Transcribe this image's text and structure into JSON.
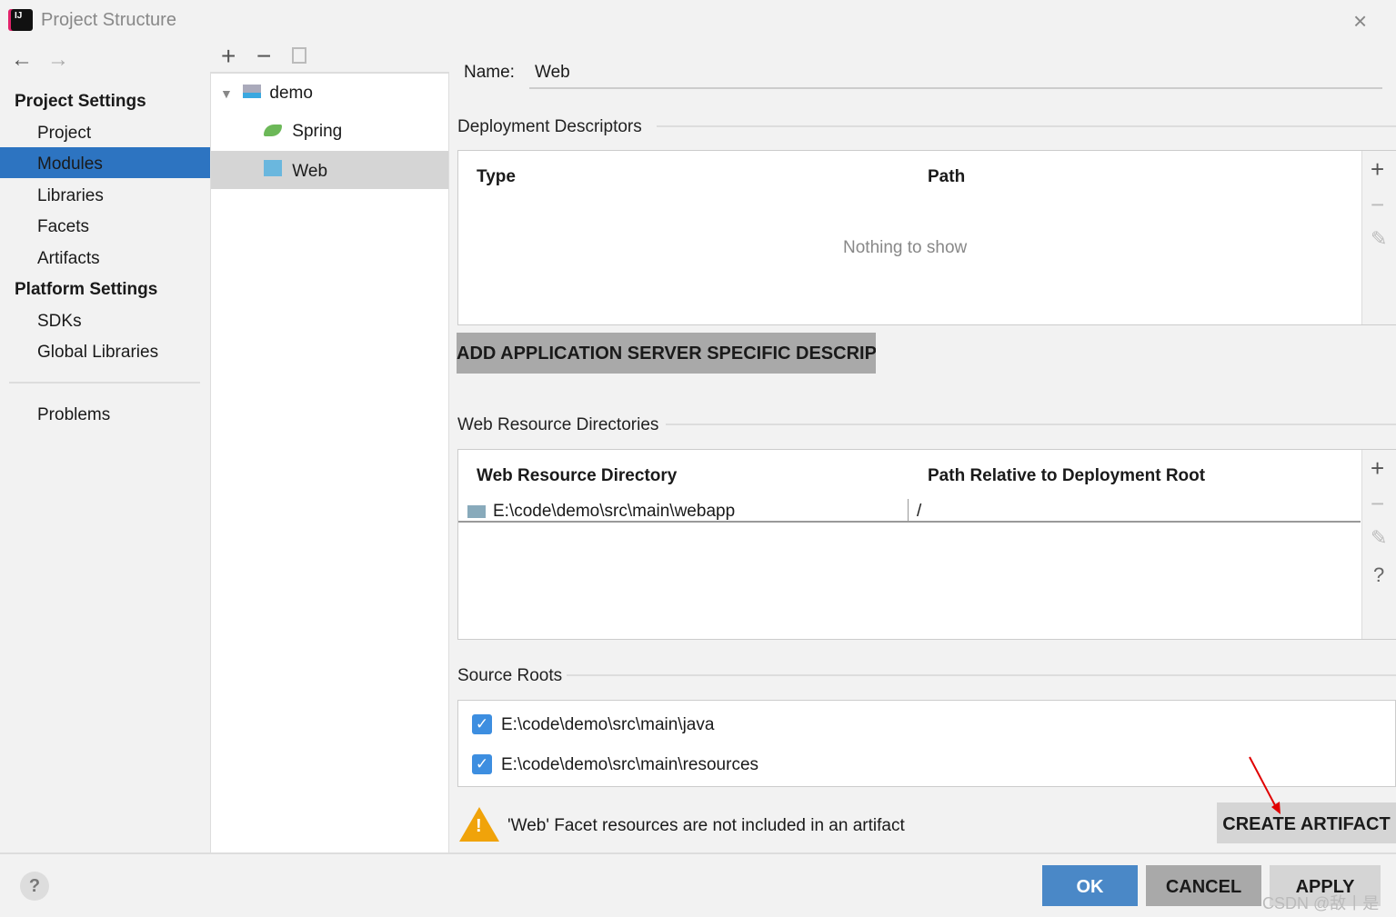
{
  "window": {
    "title": "Project Structure",
    "close": "×"
  },
  "nav": {
    "back": "←",
    "forward": "→"
  },
  "sidebar": {
    "project_settings": "Project Settings",
    "items": [
      "Project",
      "Modules",
      "Libraries",
      "Facets",
      "Artifacts"
    ],
    "platform_settings": "Platform Settings",
    "platform_items": [
      "SDKs",
      "Global Libraries"
    ],
    "problems": "Problems"
  },
  "tree": {
    "toolbar": {
      "add": "+",
      "remove": "−"
    },
    "items": [
      {
        "label": "demo"
      },
      {
        "label": "Spring"
      },
      {
        "label": "Web"
      }
    ]
  },
  "main": {
    "name_label": "Name:",
    "name_value": "Web",
    "deployment": {
      "title": "Deployment Descriptors",
      "col_type": "Type",
      "col_path": "Path",
      "empty": "Nothing to show",
      "add_button": "ADD APPLICATION SERVER SPECIFIC DESCRIPTOR..."
    },
    "web_resources": {
      "title": "Web Resource Directories",
      "col_dir": "Web Resource Directory",
      "col_rel": "Path Relative to Deployment Root",
      "rows": [
        {
          "dir": "E:\\code\\demo\\src\\main\\webapp",
          "rel": "/"
        }
      ]
    },
    "source_roots": {
      "title": "Source Roots",
      "items": [
        {
          "path": "E:\\code\\demo\\src\\main\\java",
          "checked": true
        },
        {
          "path": "E:\\code\\demo\\src\\main\\resources",
          "checked": true
        }
      ]
    },
    "warning": "'Web' Facet resources are not included in an artifact",
    "create_artifact": "CREATE ARTIFACT"
  },
  "footer": {
    "help": "?",
    "ok": "OK",
    "cancel": "CANCEL",
    "apply": "APPLY",
    "watermark": "CSDN @敌丨是"
  },
  "colors": {
    "selection": "#2d74c1",
    "ok": "#4a88c7",
    "annotation_arrow": "#e00000"
  }
}
